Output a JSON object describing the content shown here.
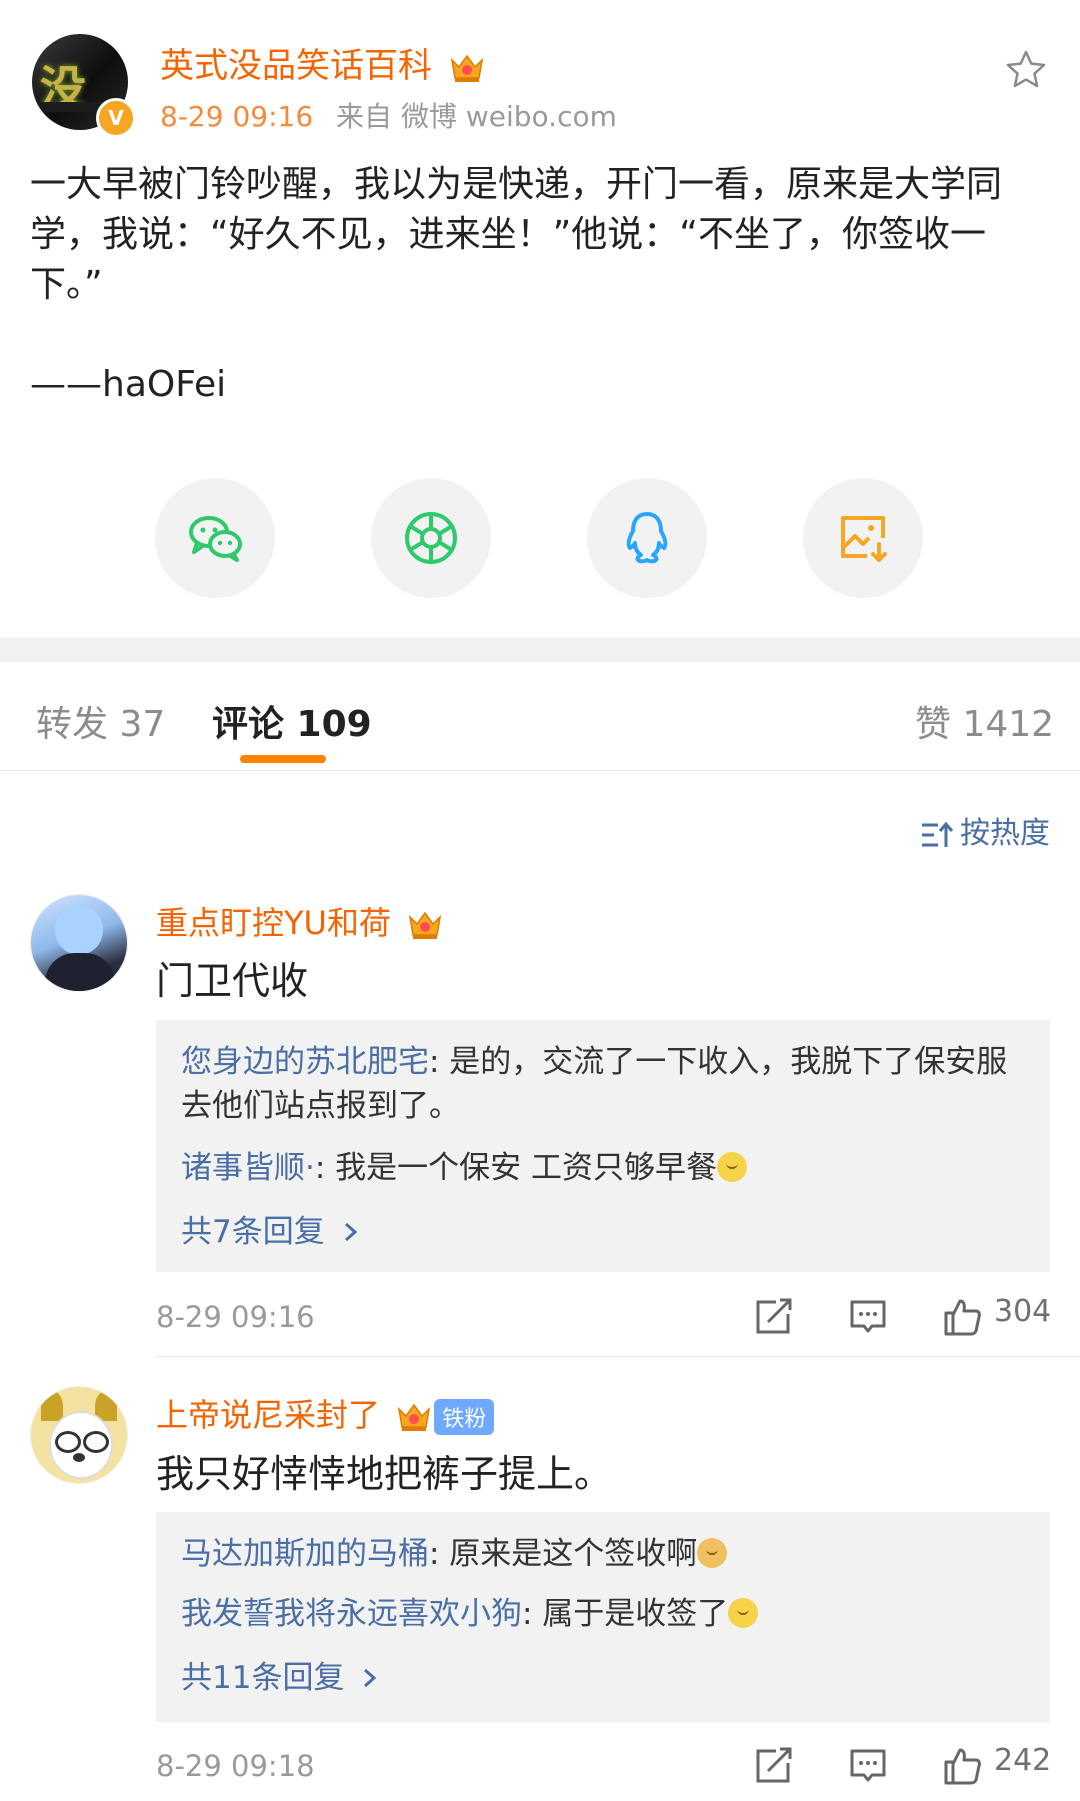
{
  "post": {
    "author": "英式没品笑话百科",
    "time": "8-29 09:16",
    "source": "来自 微博 weibo.com",
    "verified_badge": "V",
    "content": "一大早被门铃吵醒，我以为是快递，开门一看，原来是大学同学，我说：“好久不见，进来坐！”他说：“不坐了，你签收一下。”",
    "signature": "——haOFei"
  },
  "share_icons": [
    "wechat-icon",
    "moments-icon",
    "qq-icon",
    "save-image-icon"
  ],
  "tabs": {
    "repost": "转发 37",
    "comments": "评论 109",
    "likes": "赞 1412"
  },
  "sort": {
    "label": "按热度"
  },
  "comments": [
    {
      "name": "重点盯控YU和荷",
      "text": "门卫代收",
      "replies": [
        {
          "name": "您身边的苏北肥宅",
          "text": ": 是的，交流了一下收入，我脱下了保安服去他们站点报到了。"
        },
        {
          "name": "诸事皆顺·",
          "text": ": 我是一个保安 工资只够早餐"
        }
      ],
      "more": "共7条回复",
      "time": "8-29 09:16",
      "likes": "304"
    },
    {
      "name": "上帝说尼采封了",
      "fan_badge": "铁粉",
      "text": "我只好悻悻地把裤子提上。",
      "replies": [
        {
          "name": "马达加斯加的马桶",
          "text": ": 原来是这个签收啊"
        },
        {
          "name": "我发誓我将永远喜欢小狗",
          "text": ": 属于是收签了"
        }
      ],
      "more": "共11条回复",
      "time": "8-29 09:18",
      "likes": "242"
    }
  ],
  "colors": {
    "accent": "#ff8200",
    "name_orange": "#f56400",
    "link_blue": "#4a6fa5",
    "wechat_green": "#2fc96b",
    "qq_blue": "#2aa5ff",
    "save_orange": "#f5a623"
  }
}
